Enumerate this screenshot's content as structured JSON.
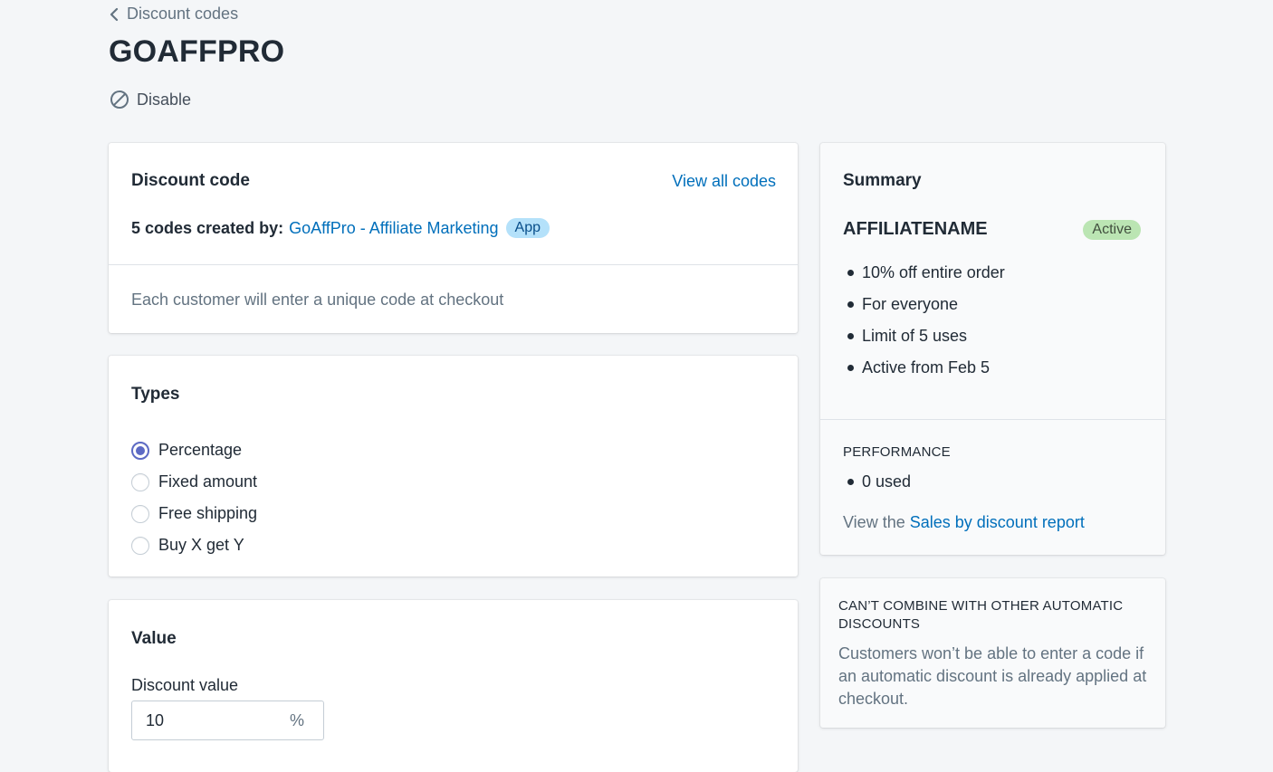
{
  "breadcrumb": {
    "label": "Discount codes"
  },
  "page": {
    "title": "GOAFFPRO",
    "disable_label": "Disable"
  },
  "discount_code_card": {
    "heading": "Discount code",
    "view_all_label": "View all codes",
    "created_prefix": "5 codes created by:",
    "created_by": "GoAffPro - Affiliate Marketing",
    "app_badge": "App",
    "note": "Each customer will enter a unique code at checkout"
  },
  "types_card": {
    "heading": "Types",
    "options": [
      {
        "label": "Percentage",
        "checked": true
      },
      {
        "label": "Fixed amount",
        "checked": false
      },
      {
        "label": "Free shipping",
        "checked": false
      },
      {
        "label": "Buy X get Y",
        "checked": false
      }
    ]
  },
  "value_card": {
    "heading": "Value",
    "field_label": "Discount value",
    "value": "10",
    "suffix": "%"
  },
  "summary": {
    "heading": "Summary",
    "code_name": "AFFILIATENAME",
    "status": "Active",
    "details": [
      "10% off entire order",
      "For everyone",
      "Limit of 5 uses",
      "Active from Feb 5"
    ],
    "performance_heading": "PERFORMANCE",
    "performance": [
      "0 used"
    ],
    "report_prefix": "View the",
    "report_link": "Sales by discount report"
  },
  "combine": {
    "heading": "CAN’T COMBINE WITH OTHER AUTOMATIC DISCOUNTS",
    "body": "Customers won’t be able to enter a code if an automatic discount is already applied at checkout."
  },
  "colors": {
    "background": "#f4f6f8",
    "link": "#006fbb",
    "radio_accent": "#5c6ac4",
    "app_badge_bg": "#b4e1fa",
    "active_badge_bg": "#bbe5b3"
  },
  "icons": {
    "breadcrumb": "chevron-left-icon",
    "disable": "circle-slash-icon"
  }
}
